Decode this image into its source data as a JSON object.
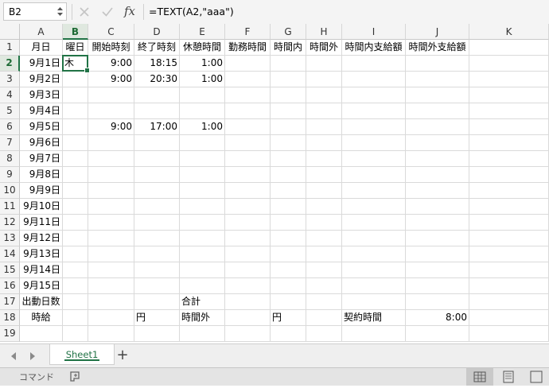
{
  "formula_bar": {
    "name_box": "B2",
    "fx_label": "fx",
    "formula": "=TEXT(A2,\"aaa\")"
  },
  "columns": [
    "A",
    "B",
    "C",
    "D",
    "E",
    "F",
    "G",
    "H",
    "I",
    "J",
    "K"
  ],
  "selected_cell": {
    "col": "B",
    "row": 2
  },
  "rows": [
    {
      "num": "1",
      "A": "月日",
      "B": "曜日",
      "C": "開始時刻",
      "D": "終了時刻",
      "E": "休憩時間",
      "F": "勤務時間",
      "G": "時間内",
      "H": "時間外",
      "I": "時間内支給額",
      "J": "時間外支給額"
    },
    {
      "num": "2",
      "A": "9月1日",
      "B": "木",
      "C": "9:00",
      "D": "18:15",
      "E": "1:00"
    },
    {
      "num": "3",
      "A": "9月2日",
      "C": "9:00",
      "D": "20:30",
      "E": "1:00"
    },
    {
      "num": "4",
      "A": "9月3日"
    },
    {
      "num": "5",
      "A": "9月4日"
    },
    {
      "num": "6",
      "A": "9月5日",
      "C": "9:00",
      "D": "17:00",
      "E": "1:00"
    },
    {
      "num": "7",
      "A": "9月6日"
    },
    {
      "num": "8",
      "A": "9月7日"
    },
    {
      "num": "9",
      "A": "9月8日"
    },
    {
      "num": "10",
      "A": "9月9日"
    },
    {
      "num": "11",
      "A": "9月10日"
    },
    {
      "num": "12",
      "A": "9月11日"
    },
    {
      "num": "13",
      "A": "9月12日"
    },
    {
      "num": "14",
      "A": "9月13日"
    },
    {
      "num": "15",
      "A": "9月14日"
    },
    {
      "num": "16",
      "A": "9月15日"
    },
    {
      "num": "17",
      "A": "出動日数",
      "E": "合計"
    },
    {
      "num": "18",
      "A": "時給",
      "D": "円",
      "E": "時間外",
      "G": "円",
      "I": "契約時間",
      "J": "8:00"
    },
    {
      "num": "19"
    }
  ],
  "sheet_tabs": {
    "active": "Sheet1",
    "add_label": "+"
  },
  "status_bar": {
    "mode": "コマンド"
  },
  "colors": {
    "accent": "#217346"
  }
}
